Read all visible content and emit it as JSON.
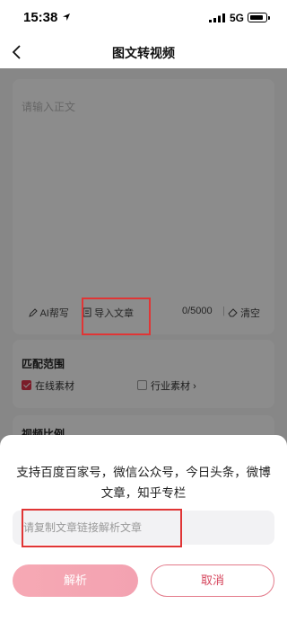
{
  "status_bar": {
    "time": "15:38",
    "network": "5G"
  },
  "nav": {
    "title": "图文转视频"
  },
  "editor": {
    "placeholder": "请输入正文",
    "ai_label": "AI帮写",
    "import_label": "导入文章",
    "char_count": "0/5000",
    "clear_label": "清空"
  },
  "match_range": {
    "title": "匹配范围",
    "options": [
      {
        "label": "在线素材",
        "checked": true
      },
      {
        "label": "行业素材",
        "checked": false
      }
    ]
  },
  "video_ratio": {
    "title": "视频比例"
  },
  "sheet": {
    "description": "支持百度百家号，微信公众号，今日头条，微博文章，知乎专栏",
    "input_placeholder": "请复制文章链接解析文章",
    "parse_label": "解析",
    "cancel_label": "取消"
  },
  "colors": {
    "accent": "#e0344c",
    "highlight_box": "#e03535"
  }
}
